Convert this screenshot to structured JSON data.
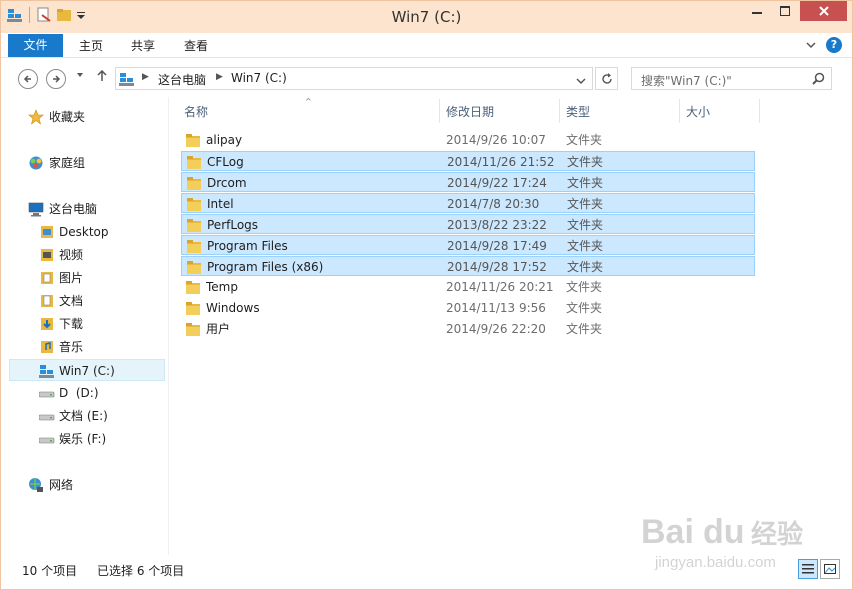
{
  "window": {
    "title": "Win7 (C:)",
    "controls": {
      "minimize": "—",
      "maximize": "□",
      "close": "✕"
    }
  },
  "ribbon": {
    "tabs": [
      {
        "label": "文件"
      },
      {
        "label": "主页"
      },
      {
        "label": "共享"
      },
      {
        "label": "查看"
      }
    ],
    "help": "?"
  },
  "address": {
    "crumbs": [
      "这台电脑",
      "Win7 (C:)"
    ],
    "search_placeholder": "搜索\"Win7 (C:)\""
  },
  "nav": {
    "favorites": "收藏夹",
    "homegroup": "家庭组",
    "thispc": "这台电脑",
    "items": [
      {
        "label": "Desktop"
      },
      {
        "label": "视频"
      },
      {
        "label": "图片"
      },
      {
        "label": "文档"
      },
      {
        "label": "下载"
      },
      {
        "label": "音乐"
      },
      {
        "label": "Win7 (C:)"
      },
      {
        "label": "D  (D:)"
      },
      {
        "label": "文档 (E:)"
      },
      {
        "label": "娱乐 (F:)"
      }
    ],
    "network": "网络"
  },
  "columns": {
    "name": "名称",
    "date": "修改日期",
    "type": "类型",
    "size": "大小"
  },
  "files": [
    {
      "name": "alipay",
      "date": "2014/9/26 10:07",
      "type": "文件夹",
      "selected": false
    },
    {
      "name": "CFLog",
      "date": "2014/11/26 21:52",
      "type": "文件夹",
      "selected": true
    },
    {
      "name": "Drcom",
      "date": "2014/9/22 17:24",
      "type": "文件夹",
      "selected": true
    },
    {
      "name": "Intel",
      "date": "2014/7/8 20:30",
      "type": "文件夹",
      "selected": true
    },
    {
      "name": "PerfLogs",
      "date": "2013/8/22 23:22",
      "type": "文件夹",
      "selected": true
    },
    {
      "name": "Program Files",
      "date": "2014/9/28 17:49",
      "type": "文件夹",
      "selected": true
    },
    {
      "name": "Program Files (x86)",
      "date": "2014/9/28 17:52",
      "type": "文件夹",
      "selected": true
    },
    {
      "name": "Temp",
      "date": "2014/11/26 20:21",
      "type": "文件夹",
      "selected": false
    },
    {
      "name": "Windows",
      "date": "2014/11/13 9:56",
      "type": "文件夹",
      "selected": false
    },
    {
      "name": "用户",
      "date": "2014/9/26 22:20",
      "type": "文件夹",
      "selected": false
    }
  ],
  "status": {
    "count": "10 个项目",
    "selected": "已选择 6 个项目"
  },
  "watermark": {
    "brand": "Baidu经验",
    "url": "jingyan.baidu.com"
  },
  "colors": {
    "titlebar": "#fce4ce",
    "accent": "#1979ca",
    "selection_fill": "#cce8ff",
    "selection_border": "#99d1ff",
    "folder": "#e8b93e",
    "close": "#c75050"
  }
}
